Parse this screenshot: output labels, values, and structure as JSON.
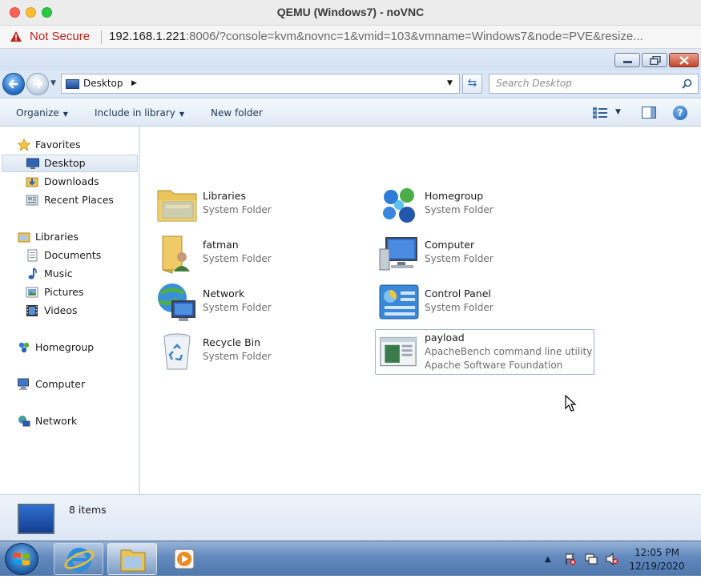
{
  "mac_window": {
    "title": "QEMU (Windows7) - noVNC"
  },
  "address_bar": {
    "security_label": "Not Secure",
    "url_host": "192.168.1.221",
    "url_rest": ":8006/?console=kvm&novnc=1&vmid=103&vmname=Windows7&node=PVE&resize..."
  },
  "explorer": {
    "breadcrumb": "Desktop",
    "search_placeholder": "Search Desktop",
    "toolbar": {
      "organize": "Organize",
      "include_in_library": "Include in library",
      "new_folder": "New folder"
    },
    "nav": {
      "favorites": "Favorites",
      "desktop": "Desktop",
      "downloads": "Downloads",
      "recent_places": "Recent Places",
      "libraries": "Libraries",
      "documents": "Documents",
      "music": "Music",
      "pictures": "Pictures",
      "videos": "Videos",
      "homegroup": "Homegroup",
      "computer": "Computer",
      "network": "Network"
    },
    "items": [
      {
        "name": "Libraries",
        "sub": "System Folder"
      },
      {
        "name": "Homegroup",
        "sub": "System Folder"
      },
      {
        "name": "fatman",
        "sub": "System Folder"
      },
      {
        "name": "Computer",
        "sub": "System Folder"
      },
      {
        "name": "Network",
        "sub": "System Folder"
      },
      {
        "name": "Control Panel",
        "sub": "System Folder"
      },
      {
        "name": "Recycle Bin",
        "sub": "System Folder"
      },
      {
        "name": "payload",
        "sub": "ApacheBench command line utility",
        "sub2": "Apache Software Foundation"
      }
    ],
    "status": {
      "count": "8 items"
    }
  },
  "taskbar": {
    "clock_time": "12:05 PM",
    "clock_date": "12/19/2020"
  },
  "colors": {
    "not_secure": "#c5221f",
    "explorer_frame": "#dbe7f5",
    "taskbar": "#6189bd"
  }
}
